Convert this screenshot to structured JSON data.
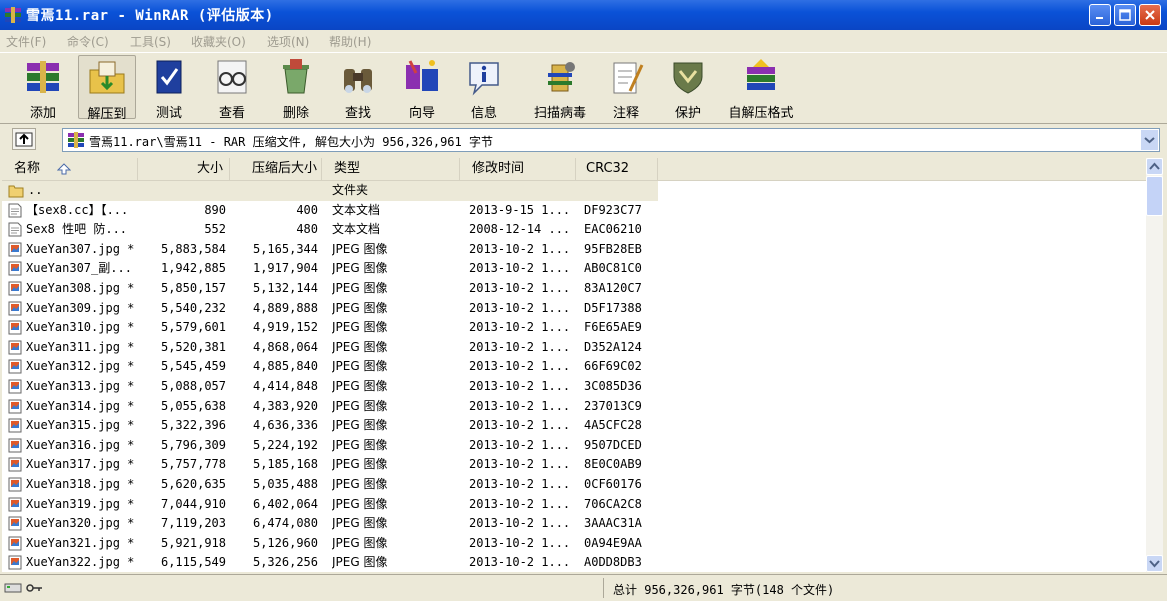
{
  "window": {
    "title": "雪焉11.rar - WinRAR (评估版本)"
  },
  "menu": [
    {
      "label": "文件(F)"
    },
    {
      "label": "命令(C)"
    },
    {
      "label": "工具(S)"
    },
    {
      "label": "收藏夹(O)"
    },
    {
      "label": "选项(N)"
    },
    {
      "label": "帮助(H)"
    }
  ],
  "toolbar": [
    {
      "label": "添加",
      "icon": "add-books-icon"
    },
    {
      "label": "解压到",
      "icon": "extract-folder-icon"
    },
    {
      "label": "测试",
      "icon": "test-book-icon"
    },
    {
      "label": "查看",
      "icon": "view-glasses-icon"
    },
    {
      "label": "删除",
      "icon": "recycle-bin-icon"
    },
    {
      "label": "查找",
      "icon": "binoculars-icon"
    },
    {
      "label": "向导",
      "icon": "wizard-icon"
    },
    {
      "label": "信息",
      "icon": "info-icon"
    },
    {
      "label": "扫描病毒",
      "icon": "virus-scan-icon"
    },
    {
      "label": "注释",
      "icon": "comment-icon"
    },
    {
      "label": "保护",
      "icon": "shield-icon"
    },
    {
      "label": "自解压格式",
      "icon": "sfx-icon"
    }
  ],
  "address": {
    "path": "雪焉11.rar\\雪焉11 - RAR 压缩文件, 解包大小为 956,326,961 字节"
  },
  "columns": {
    "name": "名称",
    "size": "大小",
    "packed": "压缩后大小",
    "type": "类型",
    "modified": "修改时间",
    "crc": "CRC32"
  },
  "updir": {
    "name": "..",
    "type": "文件夹"
  },
  "files": [
    {
      "name": "【sex8.cc】【...",
      "size": "890",
      "packed": "400",
      "type": "文本文档",
      "modified": "2013-9-15 1...",
      "crc": "DF923C77",
      "icon": "text-file-icon"
    },
    {
      "name": "Sex8 性吧 防...",
      "size": "552",
      "packed": "480",
      "type": "文本文档",
      "modified": "2008-12-14 ...",
      "crc": "EAC06210",
      "icon": "text-file-icon"
    },
    {
      "name": "XueYan307.jpg *",
      "size": "5,883,584",
      "packed": "5,165,344",
      "type": "JPEG 图像",
      "modified": "2013-10-2 1...",
      "crc": "95FB28EB",
      "icon": "image-file-icon"
    },
    {
      "name": "XueYan307_副...",
      "size": "1,942,885",
      "packed": "1,917,904",
      "type": "JPEG 图像",
      "modified": "2013-10-2 1...",
      "crc": "AB0C81C0",
      "icon": "image-file-icon"
    },
    {
      "name": "XueYan308.jpg *",
      "size": "5,850,157",
      "packed": "5,132,144",
      "type": "JPEG 图像",
      "modified": "2013-10-2 1...",
      "crc": "83A120C7",
      "icon": "image-file-icon"
    },
    {
      "name": "XueYan309.jpg *",
      "size": "5,540,232",
      "packed": "4,889,888",
      "type": "JPEG 图像",
      "modified": "2013-10-2 1...",
      "crc": "D5F17388",
      "icon": "image-file-icon"
    },
    {
      "name": "XueYan310.jpg *",
      "size": "5,579,601",
      "packed": "4,919,152",
      "type": "JPEG 图像",
      "modified": "2013-10-2 1...",
      "crc": "F6E65AE9",
      "icon": "image-file-icon"
    },
    {
      "name": "XueYan311.jpg *",
      "size": "5,520,381",
      "packed": "4,868,064",
      "type": "JPEG 图像",
      "modified": "2013-10-2 1...",
      "crc": "D352A124",
      "icon": "image-file-icon"
    },
    {
      "name": "XueYan312.jpg *",
      "size": "5,545,459",
      "packed": "4,885,840",
      "type": "JPEG 图像",
      "modified": "2013-10-2 1...",
      "crc": "66F69C02",
      "icon": "image-file-icon"
    },
    {
      "name": "XueYan313.jpg *",
      "size": "5,088,057",
      "packed": "4,414,848",
      "type": "JPEG 图像",
      "modified": "2013-10-2 1...",
      "crc": "3C085D36",
      "icon": "image-file-icon"
    },
    {
      "name": "XueYan314.jpg *",
      "size": "5,055,638",
      "packed": "4,383,920",
      "type": "JPEG 图像",
      "modified": "2013-10-2 1...",
      "crc": "237013C9",
      "icon": "image-file-icon"
    },
    {
      "name": "XueYan315.jpg *",
      "size": "5,322,396",
      "packed": "4,636,336",
      "type": "JPEG 图像",
      "modified": "2013-10-2 1...",
      "crc": "4A5CFC28",
      "icon": "image-file-icon"
    },
    {
      "name": "XueYan316.jpg *",
      "size": "5,796,309",
      "packed": "5,224,192",
      "type": "JPEG 图像",
      "modified": "2013-10-2 1...",
      "crc": "9507DCED",
      "icon": "image-file-icon"
    },
    {
      "name": "XueYan317.jpg *",
      "size": "5,757,778",
      "packed": "5,185,168",
      "type": "JPEG 图像",
      "modified": "2013-10-2 1...",
      "crc": "8E0C0AB9",
      "icon": "image-file-icon"
    },
    {
      "name": "XueYan318.jpg *",
      "size": "5,620,635",
      "packed": "5,035,488",
      "type": "JPEG 图像",
      "modified": "2013-10-2 1...",
      "crc": "0CF60176",
      "icon": "image-file-icon"
    },
    {
      "name": "XueYan319.jpg *",
      "size": "7,044,910",
      "packed": "6,402,064",
      "type": "JPEG 图像",
      "modified": "2013-10-2 1...",
      "crc": "706CA2C8",
      "icon": "image-file-icon"
    },
    {
      "name": "XueYan320.jpg *",
      "size": "7,119,203",
      "packed": "6,474,080",
      "type": "JPEG 图像",
      "modified": "2013-10-2 1...",
      "crc": "3AAAC31A",
      "icon": "image-file-icon"
    },
    {
      "name": "XueYan321.jpg *",
      "size": "5,921,918",
      "packed": "5,126,960",
      "type": "JPEG 图像",
      "modified": "2013-10-2 1...",
      "crc": "0A94E9AA",
      "icon": "image-file-icon"
    },
    {
      "name": "XueYan322.jpg *",
      "size": "6,115,549",
      "packed": "5,326,256",
      "type": "JPEG 图像",
      "modified": "2013-10-2 1...",
      "crc": "A0DD8DB3",
      "icon": "image-file-icon"
    }
  ],
  "status": {
    "right": "总计 956,326,961 字节(148 个文件)"
  }
}
